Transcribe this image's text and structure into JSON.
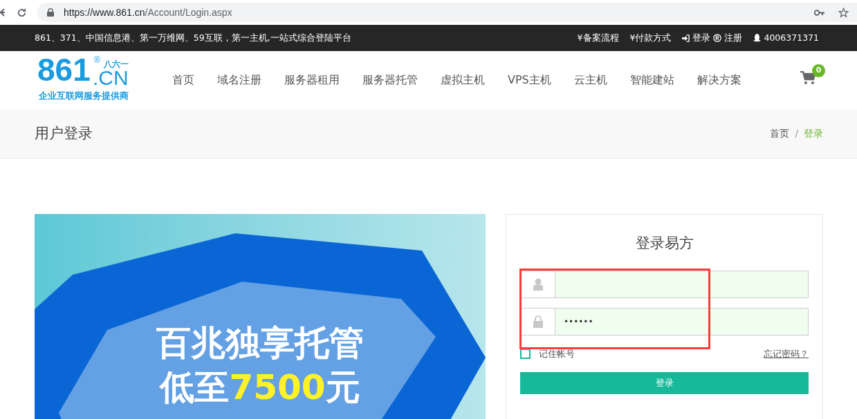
{
  "browser": {
    "url_host": "https://www.861.cn",
    "url_path": "/Account/Login.aspx"
  },
  "top_bar": {
    "slogan": "861、371、中国信息港、第一万维网、59互联，第一主机,一站式综合登陆平台",
    "links": [
      {
        "kind": "plain",
        "label": "¥备案流程"
      },
      {
        "kind": "plain",
        "label": "¥付款方式"
      },
      {
        "kind": "login",
        "label": "登录"
      },
      {
        "kind": "register",
        "label": "注册"
      },
      {
        "kind": "qq",
        "label": "4006371371"
      }
    ]
  },
  "logo": {
    "number": "861",
    "suffix": ".CN",
    "mark": "®",
    "pinyin": "八六一",
    "tagline": "企业互联网服务提供商"
  },
  "nav": [
    {
      "label": "首页"
    },
    {
      "label": "域名注册"
    },
    {
      "label": "服务器租用"
    },
    {
      "label": "服务器托管"
    },
    {
      "label": "虚拟主机"
    },
    {
      "label": "VPS主机"
    },
    {
      "label": "云主机"
    },
    {
      "label": "智能建站"
    },
    {
      "label": "解决方案"
    }
  ],
  "cart": {
    "count": "0"
  },
  "page_header": {
    "title": "用户登录",
    "breadcrumb": [
      {
        "label": "首页",
        "selected": false
      },
      {
        "label": "登录",
        "selected": true
      }
    ],
    "separator": "/"
  },
  "banner": {
    "line_1": "百兆独享托管",
    "line_2_prefix": "低至",
    "line_2_highlight": "7500",
    "line_2_suffix": "元"
  },
  "login_card": {
    "title": "登录易方",
    "password_value": "••••••",
    "remember": {
      "label": "记住帐号",
      "checked": false
    },
    "forgot_link": "忘记密码？",
    "submit": "登录"
  }
}
